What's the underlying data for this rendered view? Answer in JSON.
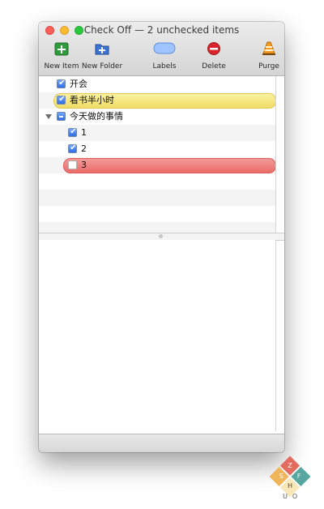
{
  "window": {
    "title": "Check Off — 2 unchecked items"
  },
  "toolbar": {
    "new_item": "New Item",
    "new_folder": "New Folder",
    "labels": "Labels",
    "delete": "Delete",
    "purge": "Purge"
  },
  "items": [
    {
      "text": "开会",
      "state": "checked"
    },
    {
      "text": "看书半小时",
      "state": "checked",
      "label_color": "#f2df6c"
    },
    {
      "text": "今天做的事情",
      "state": "mixed",
      "folder": true,
      "expanded": true
    },
    {
      "text": "1",
      "state": "checked"
    },
    {
      "text": "2",
      "state": "checked"
    },
    {
      "text": "3",
      "state": "unchecked",
      "label_color": "#ec7472"
    }
  ],
  "logo": {
    "letters": [
      "S",
      "Z",
      "F",
      "H",
      "U",
      "O"
    ],
    "colors": [
      "#f0b45a",
      "#e36c5e",
      "#57a7a0",
      "#f7e7b9"
    ]
  }
}
